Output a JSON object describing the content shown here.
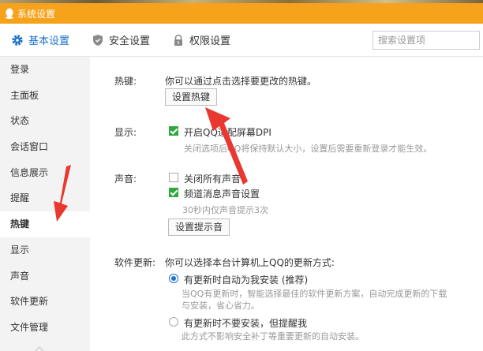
{
  "window": {
    "title": "系统设置"
  },
  "toolbar": {
    "tabs": [
      {
        "label": "基本设置",
        "icon": "gear-icon"
      },
      {
        "label": "安全设置",
        "icon": "shield-icon"
      },
      {
        "label": "权限设置",
        "icon": "lock-icon"
      }
    ],
    "search_placeholder": "搜索设置项"
  },
  "sidebar": {
    "items": [
      "登录",
      "主面板",
      "状态",
      "会话窗口",
      "信息展示",
      "提醒",
      "热键",
      "显示",
      "声音",
      "软件更新",
      "文件管理"
    ],
    "active": "热键"
  },
  "hotkey": {
    "label": "热键:",
    "description": "你可以通过点击选择要更改的热键。",
    "button": "设置热键"
  },
  "display": {
    "label": "显示:",
    "option": "开启QQ适配屏幕DPI",
    "hint": "关闭选项后QQ将保持默认大小，设置后需要重新登录才能生效。"
  },
  "sound": {
    "label": "声音:",
    "option_mute": "关闭所有声音",
    "option_channel": "频道消息声音设置",
    "hint": "30秒内仅声音提示3次",
    "button": "设置提示音"
  },
  "update": {
    "label": "软件更新:",
    "description": "你可以选择本台计算机上QQ的更新方式:",
    "option_auto": "有更新时自动为我安装 (推荐)",
    "option_auto_hint_1": "当QQ有更新时，智能选择最佳的软件更新方案，自动完成更新的下载",
    "option_auto_hint_2": "与安装，省心省力。",
    "option_notify": "有更新时不要安装，但提醒我",
    "option_notify_hint": "此方式不影响安全补丁等重要更新的自动安装。"
  },
  "colors": {
    "titlebar": "#f7a21b",
    "accent": "#1a73c9",
    "check": "#2eaa3c",
    "annotation_arrow": "#e8382f"
  }
}
